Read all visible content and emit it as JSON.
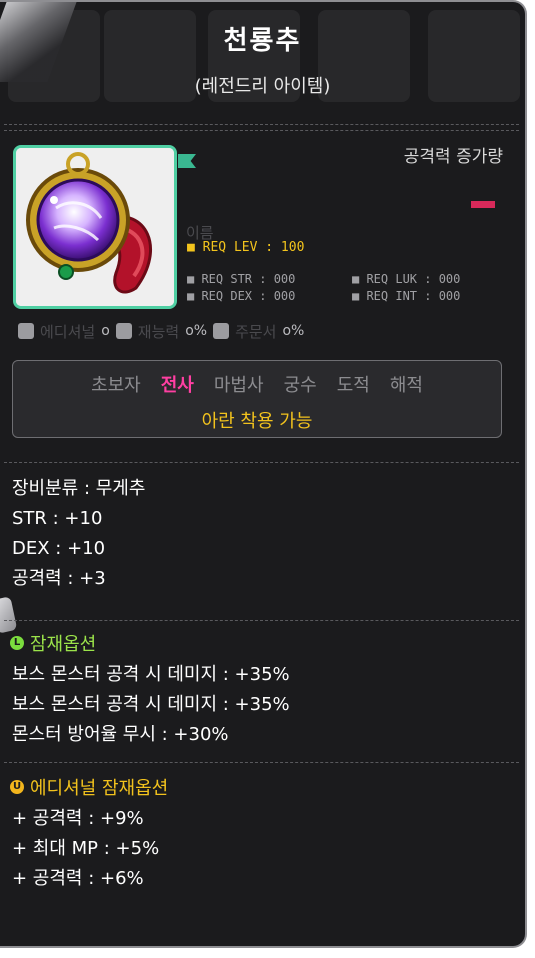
{
  "item": {
    "name": "천룡추",
    "grade": "(레전드리 아이템)"
  },
  "header": {
    "attack_increase_label": "공격력 증가량"
  },
  "requirements": {
    "level": "■ REQ LEV : 100",
    "str": "■ REQ STR : 000",
    "luk": "■ REQ LUK : 000",
    "dex": "■ REQ DEX : 000",
    "int": "■ REQ INT : 000"
  },
  "icon_row": {
    "val1": "o",
    "val2": "o%",
    "val3": "o%"
  },
  "jobs": {
    "list": [
      "초보자",
      "전사",
      "마법사",
      "궁수",
      "도적",
      "해적"
    ],
    "active_index": 1,
    "note": "아란 착용 가능"
  },
  "stats": {
    "category": "장비분류 : 무게추",
    "str": "STR : +10",
    "dex": "DEX : +10",
    "attack": "공격력 : +3"
  },
  "potential": {
    "grade_letter": "L",
    "grade_color": "#7bdc3e",
    "title": "잠재옵션",
    "title_color": "#9be34a",
    "lines": [
      "보스 몬스터 공격 시 데미지 : +35%",
      "보스 몬스터 공격 시 데미지 : +35%",
      "몬스터 방어율 무시 : +30%"
    ]
  },
  "additional": {
    "grade_letter": "U",
    "grade_color": "#f2b51d",
    "title": "에디셔널 잠재옵션",
    "title_color": "#f2c21d",
    "lines": [
      "+ 공격력 : +9%",
      "+ 최대 MP : +5%",
      "+ 공격력 : +6%"
    ]
  },
  "colors": {
    "background": "#1b1b1d",
    "border": "#8e8e92",
    "icon_border": "#4fcfa3",
    "req_lev": "#f3c41d",
    "active_job": "#ff3fa2"
  }
}
